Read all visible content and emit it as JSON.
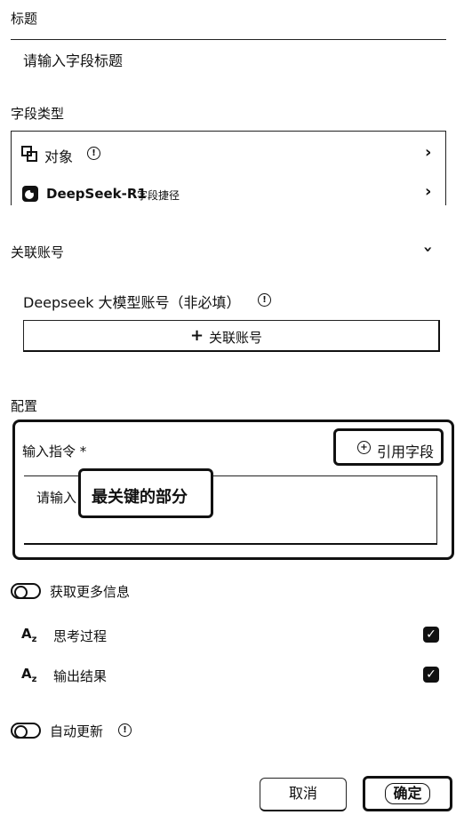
{
  "title_section": {
    "label": "标题",
    "placeholder": "请输入字段标题"
  },
  "field_type": {
    "label": "字段类型",
    "object_label": "对象",
    "model_name": "DeepSeek-R1",
    "model_tag": "字段捷径"
  },
  "linked_account": {
    "label": "关联账号",
    "account_title": "Deepseek 大模型账号（非必填）",
    "link_button": "关联账号"
  },
  "config": {
    "label": "配置",
    "input_label": "输入指令 *",
    "reference_button": "引用字段",
    "instruction_placeholder": "请输入",
    "annotation": "最关键的部分"
  },
  "more_info": {
    "toggle_label": "获取更多信息",
    "items": [
      {
        "label": "思考过程",
        "checked": true
      },
      {
        "label": "输出结果",
        "checked": true
      }
    ]
  },
  "auto_update": {
    "label": "自动更新"
  },
  "footer": {
    "cancel": "取消",
    "confirm": "确定"
  }
}
